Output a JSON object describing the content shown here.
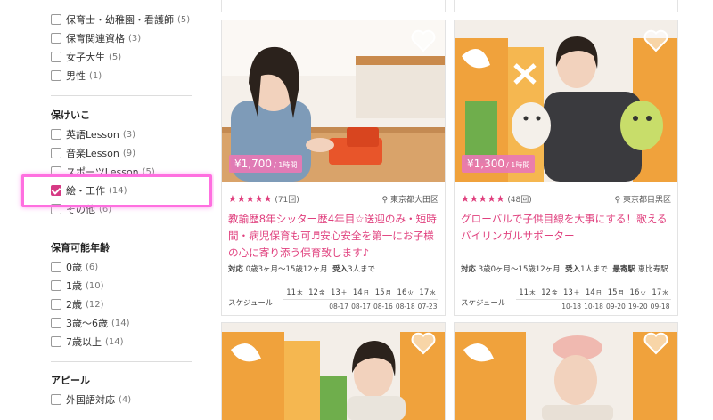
{
  "sidebar": {
    "top_items": [
      {
        "label": "保育士・幼稚園・看護師",
        "count": "(5)"
      },
      {
        "label": "保育関連資格",
        "count": "(3)"
      },
      {
        "label": "女子大生",
        "count": "(5)"
      },
      {
        "label": "男性",
        "count": "(1)"
      }
    ],
    "hoikeiko": {
      "title": "保けいこ",
      "items": [
        {
          "label": "英語Lesson",
          "count": "(3)"
        },
        {
          "label": "音楽Lesson",
          "count": "(9)"
        },
        {
          "label": "スポーツLesson",
          "count": "(5)"
        },
        {
          "label": "絵・工作",
          "count": "(14)",
          "checked": true
        },
        {
          "label": "その他",
          "count": "(6)"
        }
      ]
    },
    "age": {
      "title": "保育可能年齢",
      "items": [
        {
          "label": "0歳",
          "count": "(6)"
        },
        {
          "label": "1歳",
          "count": "(10)"
        },
        {
          "label": "2歳",
          "count": "(12)"
        },
        {
          "label": "3歳〜6歳",
          "count": "(14)"
        },
        {
          "label": "7歳以上",
          "count": "(14)"
        }
      ]
    },
    "appeal": {
      "title": "アピール",
      "items": [
        {
          "label": "外国語対応",
          "count": "(4)"
        }
      ]
    }
  },
  "cards": [
    {
      "price": "¥1,700",
      "price_unit": "/ 1時間",
      "stars": "★★★★★",
      "reviews": "(71回)",
      "location": "東京都大田区",
      "title": "教諭歴8年シッター歴4年目☆送迎のみ・短時間・病児保育も可♬安心安全を第一にお子様の心に寄り添う保育致します♪",
      "target_label": "対応",
      "target_value": "0歳3ヶ月〜15歳12ヶ月",
      "accept_label": "受入",
      "accept_value": "3人まで",
      "station": "",
      "schedule_label": "スケジュール",
      "days": [
        {
          "num": "11",
          "wd": "木",
          "date": ""
        },
        {
          "num": "12",
          "wd": "金",
          "date": ""
        },
        {
          "num": "13",
          "wd": "土",
          "date": "08-17"
        },
        {
          "num": "14",
          "wd": "日",
          "date": "08-17"
        },
        {
          "num": "15",
          "wd": "月",
          "date": "08-16"
        },
        {
          "num": "16",
          "wd": "火",
          "date": "08-18"
        },
        {
          "num": "17",
          "wd": "水",
          "date": "07-23"
        }
      ]
    },
    {
      "price": "¥1,300",
      "price_unit": "/ 1時間",
      "stars": "★★★★★",
      "reviews": "(48回)",
      "location": "東京都目黒区",
      "title": "グローバルで子供目線を大事にする！歌えるバイリンガルサポーター",
      "target_label": "対応",
      "target_value": "3歳0ヶ月〜15歳12ヶ月",
      "accept_label": "受入",
      "accept_value": "1人まで",
      "station_label": "最寄駅",
      "station": "恵比寿駅",
      "schedule_label": "スケジュール",
      "days": [
        {
          "num": "11",
          "wd": "木",
          "date": ""
        },
        {
          "num": "12",
          "wd": "金",
          "date": ""
        },
        {
          "num": "13",
          "wd": "土",
          "date": "10-18"
        },
        {
          "num": "14",
          "wd": "日",
          "date": "10-18"
        },
        {
          "num": "15",
          "wd": "月",
          "date": "09-20"
        },
        {
          "num": "16",
          "wd": "火",
          "date": "19-20"
        },
        {
          "num": "17",
          "wd": "水",
          "date": "09-18"
        }
      ]
    }
  ],
  "colors": {
    "accent": "#e0407e",
    "highlight": "#ff6fe0",
    "price_bg": "#e878b4"
  },
  "icons": {
    "heart": "heart-icon",
    "pin": "location-pin-icon"
  }
}
